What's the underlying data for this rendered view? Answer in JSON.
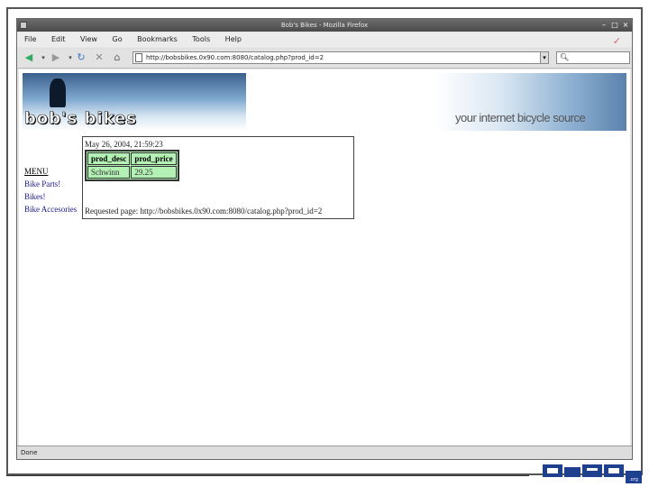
{
  "window": {
    "title": "Bob's Bikes - Mozilla Firefox"
  },
  "menubar": {
    "items": [
      "File",
      "Edit",
      "View",
      "Go",
      "Bookmarks",
      "Tools",
      "Help"
    ]
  },
  "toolbar": {
    "url": "http://bobsbikes.0x90.com:8080/catalog.php?prod_id=2",
    "search_placeholder": ""
  },
  "banner": {
    "brand": "bob's bikes",
    "slogan": "your internet bicycle source"
  },
  "nav": {
    "heading": "MENU",
    "items": [
      "Bike Parts!",
      "Bikes!",
      "Bike Accesories"
    ]
  },
  "result": {
    "timestamp": "May 26, 2004, 21:59:23",
    "columns": [
      "prod_desc",
      "prod_price"
    ],
    "rows": [
      [
        "Schwinn",
        "29.25"
      ]
    ],
    "requested": "Requested page: http://bobsbikes.0x90.com:8080/catalog.php?prod_id=2"
  },
  "statusbar": {
    "text": "Done"
  },
  "footer_logo": {
    "text": "0x90",
    "sub": ".org"
  },
  "colors": {
    "table_bg": "#b3f0b3",
    "link": "#1a1a8c",
    "logo_blue": "#1f3f8f"
  }
}
